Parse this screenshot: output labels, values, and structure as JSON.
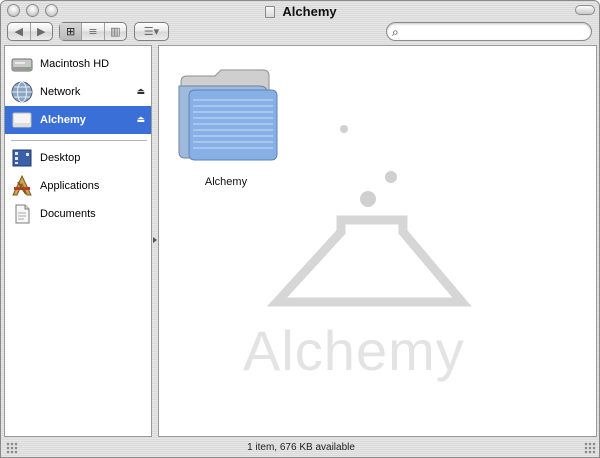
{
  "window": {
    "title": "Alchemy"
  },
  "toolbar": {
    "back_icon": "◀",
    "forward_icon": "▶",
    "view_icons": [
      "⊞",
      "≡",
      "▥"
    ],
    "action_icon": "☰▾",
    "search": {
      "value": "",
      "placeholder": ""
    }
  },
  "sidebar": {
    "devices": [
      {
        "label": "Macintosh HD",
        "icon": "hard-drive-icon",
        "eject": ""
      },
      {
        "label": "Network",
        "icon": "network-globe-icon",
        "eject": "⏏"
      },
      {
        "label": "Alchemy",
        "icon": "disk-image-icon",
        "eject": "⏏",
        "selected": true
      }
    ],
    "places": [
      {
        "label": "Desktop",
        "icon": "desktop-icon"
      },
      {
        "label": "Applications",
        "icon": "applications-icon"
      },
      {
        "label": "Documents",
        "icon": "documents-icon"
      }
    ]
  },
  "content": {
    "items": [
      {
        "label": "Alchemy",
        "icon": "folder-icon"
      }
    ],
    "background_text": "Alchemy"
  },
  "status": {
    "text": "1 item, 676 KB available"
  },
  "colors": {
    "selection": "#3a6fd8",
    "folder_blue": "#8ab4e8",
    "watermark": "#d8d8d8"
  }
}
